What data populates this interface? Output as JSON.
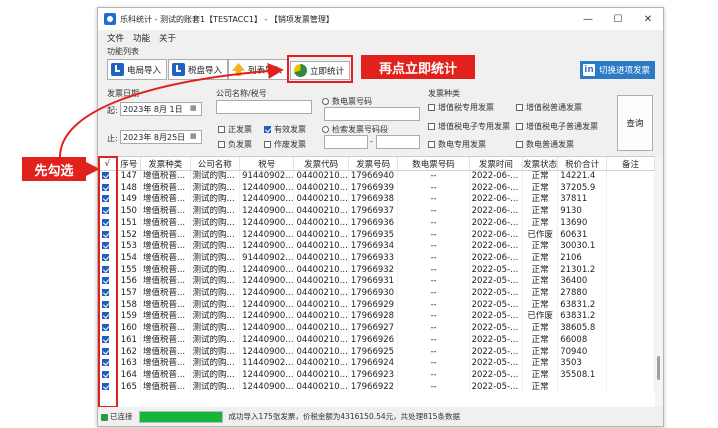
{
  "window": {
    "title": "乐科统计 - 测试的账套1【TESTACC1】 - 【销项发票管理】"
  },
  "window_controls": {
    "minimize": "—",
    "maximize": "☐",
    "close": "✕"
  },
  "menu": {
    "items": [
      "文件",
      "功能",
      "关于"
    ]
  },
  "toolbar": {
    "group_label": "功能列表",
    "import_elec": "电局导入",
    "import_tax": "税盘导入",
    "import_list": "列表导入",
    "stats": "立即统计",
    "switch_mode": "切换进项发票",
    "linkedin_badge": "in"
  },
  "filters": {
    "date_group": "发票日期",
    "from_label": "起:",
    "from_date": "2023年 8月 1日",
    "to_label": "止:",
    "to_date": "2023年 8月25日",
    "company_group": "公司名称/税号",
    "status_checks": [
      "正发票",
      "有效发票",
      "负发票",
      "作废发票"
    ],
    "status_checked": [
      false,
      true,
      false,
      false
    ],
    "radio_elec": "数电票号码",
    "radio_range": "检索发票号码段",
    "range_sep": "-",
    "type_group": "发票种类",
    "type_checks": [
      "增值税专用发票",
      "增值税普通发票",
      "增值税电子专用发票",
      "增值税电子普通发票",
      "数电专用发票",
      "数电普通发票"
    ],
    "query_btn": "查询"
  },
  "table": {
    "columns": [
      "√",
      "序号",
      "发票种类",
      "公司名称",
      "税号",
      "发票代码",
      "发票号码",
      "数电票号码",
      "发票时间",
      "发票状态",
      "税价合计",
      "备注"
    ],
    "rows": [
      [
        "147",
        "增值税普...",
        "测试的购...",
        "91440902...",
        "04400210...",
        "17966940",
        "--",
        "2022-06-...",
        "正常",
        "14221.4",
        ""
      ],
      [
        "148",
        "增值税普...",
        "测试的购...",
        "12440900...",
        "04400210...",
        "17966939",
        "--",
        "2022-06-...",
        "正常",
        "37205.9",
        ""
      ],
      [
        "149",
        "增值税普...",
        "测试的购...",
        "12440900...",
        "04400210...",
        "17966938",
        "--",
        "2022-06-...",
        "正常",
        "37811",
        ""
      ],
      [
        "150",
        "增值税普...",
        "测试的购...",
        "12440900...",
        "04400210...",
        "17966937",
        "--",
        "2022-06-...",
        "正常",
        "9130",
        ""
      ],
      [
        "151",
        "增值税普...",
        "测试的购...",
        "12440900...",
        "04400210...",
        "17966936",
        "--",
        "2022-06-...",
        "正常",
        "13690",
        ""
      ],
      [
        "152",
        "增值税普...",
        "测试的购...",
        "12440900...",
        "04400210...",
        "17966935",
        "--",
        "2022-06-...",
        "已作废",
        "60631",
        ""
      ],
      [
        "153",
        "增值税普...",
        "测试的购...",
        "12440900...",
        "04400210...",
        "17966934",
        "--",
        "2022-06-...",
        "正常",
        "30030.1",
        ""
      ],
      [
        "154",
        "增值税普...",
        "测试的购...",
        "91440902...",
        "04400210...",
        "17966933",
        "--",
        "2022-06-...",
        "正常",
        "2106",
        ""
      ],
      [
        "155",
        "增值税普...",
        "测试的购...",
        "12440900...",
        "04400210...",
        "17966932",
        "--",
        "2022-05-...",
        "正常",
        "21301.2",
        ""
      ],
      [
        "156",
        "增值税普...",
        "测试的购...",
        "12440900...",
        "04400210...",
        "17966931",
        "--",
        "2022-05-...",
        "正常",
        "36400",
        ""
      ],
      [
        "157",
        "增值税普...",
        "测试的购...",
        "12440900...",
        "04400210...",
        "17966930",
        "--",
        "2022-05-...",
        "正常",
        "27880",
        ""
      ],
      [
        "158",
        "增值税普...",
        "测试的购...",
        "12440900...",
        "04400210...",
        "17966929",
        "--",
        "2022-05-...",
        "正常",
        "63831.2",
        ""
      ],
      [
        "159",
        "增值税普...",
        "测试的购...",
        "12440900...",
        "04400210...",
        "17966928",
        "--",
        "2022-05-...",
        "已作废",
        "63831.2",
        ""
      ],
      [
        "160",
        "增值税普...",
        "测试的购...",
        "12440900...",
        "04400210...",
        "17966927",
        "--",
        "2022-05-...",
        "正常",
        "38605.8",
        ""
      ],
      [
        "161",
        "增值税普...",
        "测试的购...",
        "12440900...",
        "04400210...",
        "17966926",
        "--",
        "2022-05-...",
        "正常",
        "66008",
        ""
      ],
      [
        "162",
        "增值税普...",
        "测试的购...",
        "12440900...",
        "04400210...",
        "17966925",
        "--",
        "2022-05-...",
        "正常",
        "70940",
        ""
      ],
      [
        "163",
        "增值税普...",
        "测试的购...",
        "11440902...",
        "04400210...",
        "17966924",
        "--",
        "2022-05-...",
        "正常",
        "3503",
        ""
      ],
      [
        "164",
        "增值税普...",
        "测试的购...",
        "12440900...",
        "04400210...",
        "17966923",
        "--",
        "2022-05-...",
        "正常",
        "35508.1",
        ""
      ],
      [
        "165",
        "增值税普...",
        "测试的购...",
        "12440900...",
        "04400210...",
        "17966922",
        "--",
        "2022-05-...",
        "正常",
        "",
        ""
      ]
    ]
  },
  "status": {
    "connection": "已连接",
    "progress": 1.0,
    "message": "成功导入175张发票，价税金额为4316150.54元，共处理815条数据"
  },
  "annotations": {
    "first": "先勾选",
    "second": "再点立即统计"
  },
  "colors": {
    "highlight": "#e2211c",
    "accent": "#1e63c2",
    "progress": "#13b53a"
  }
}
